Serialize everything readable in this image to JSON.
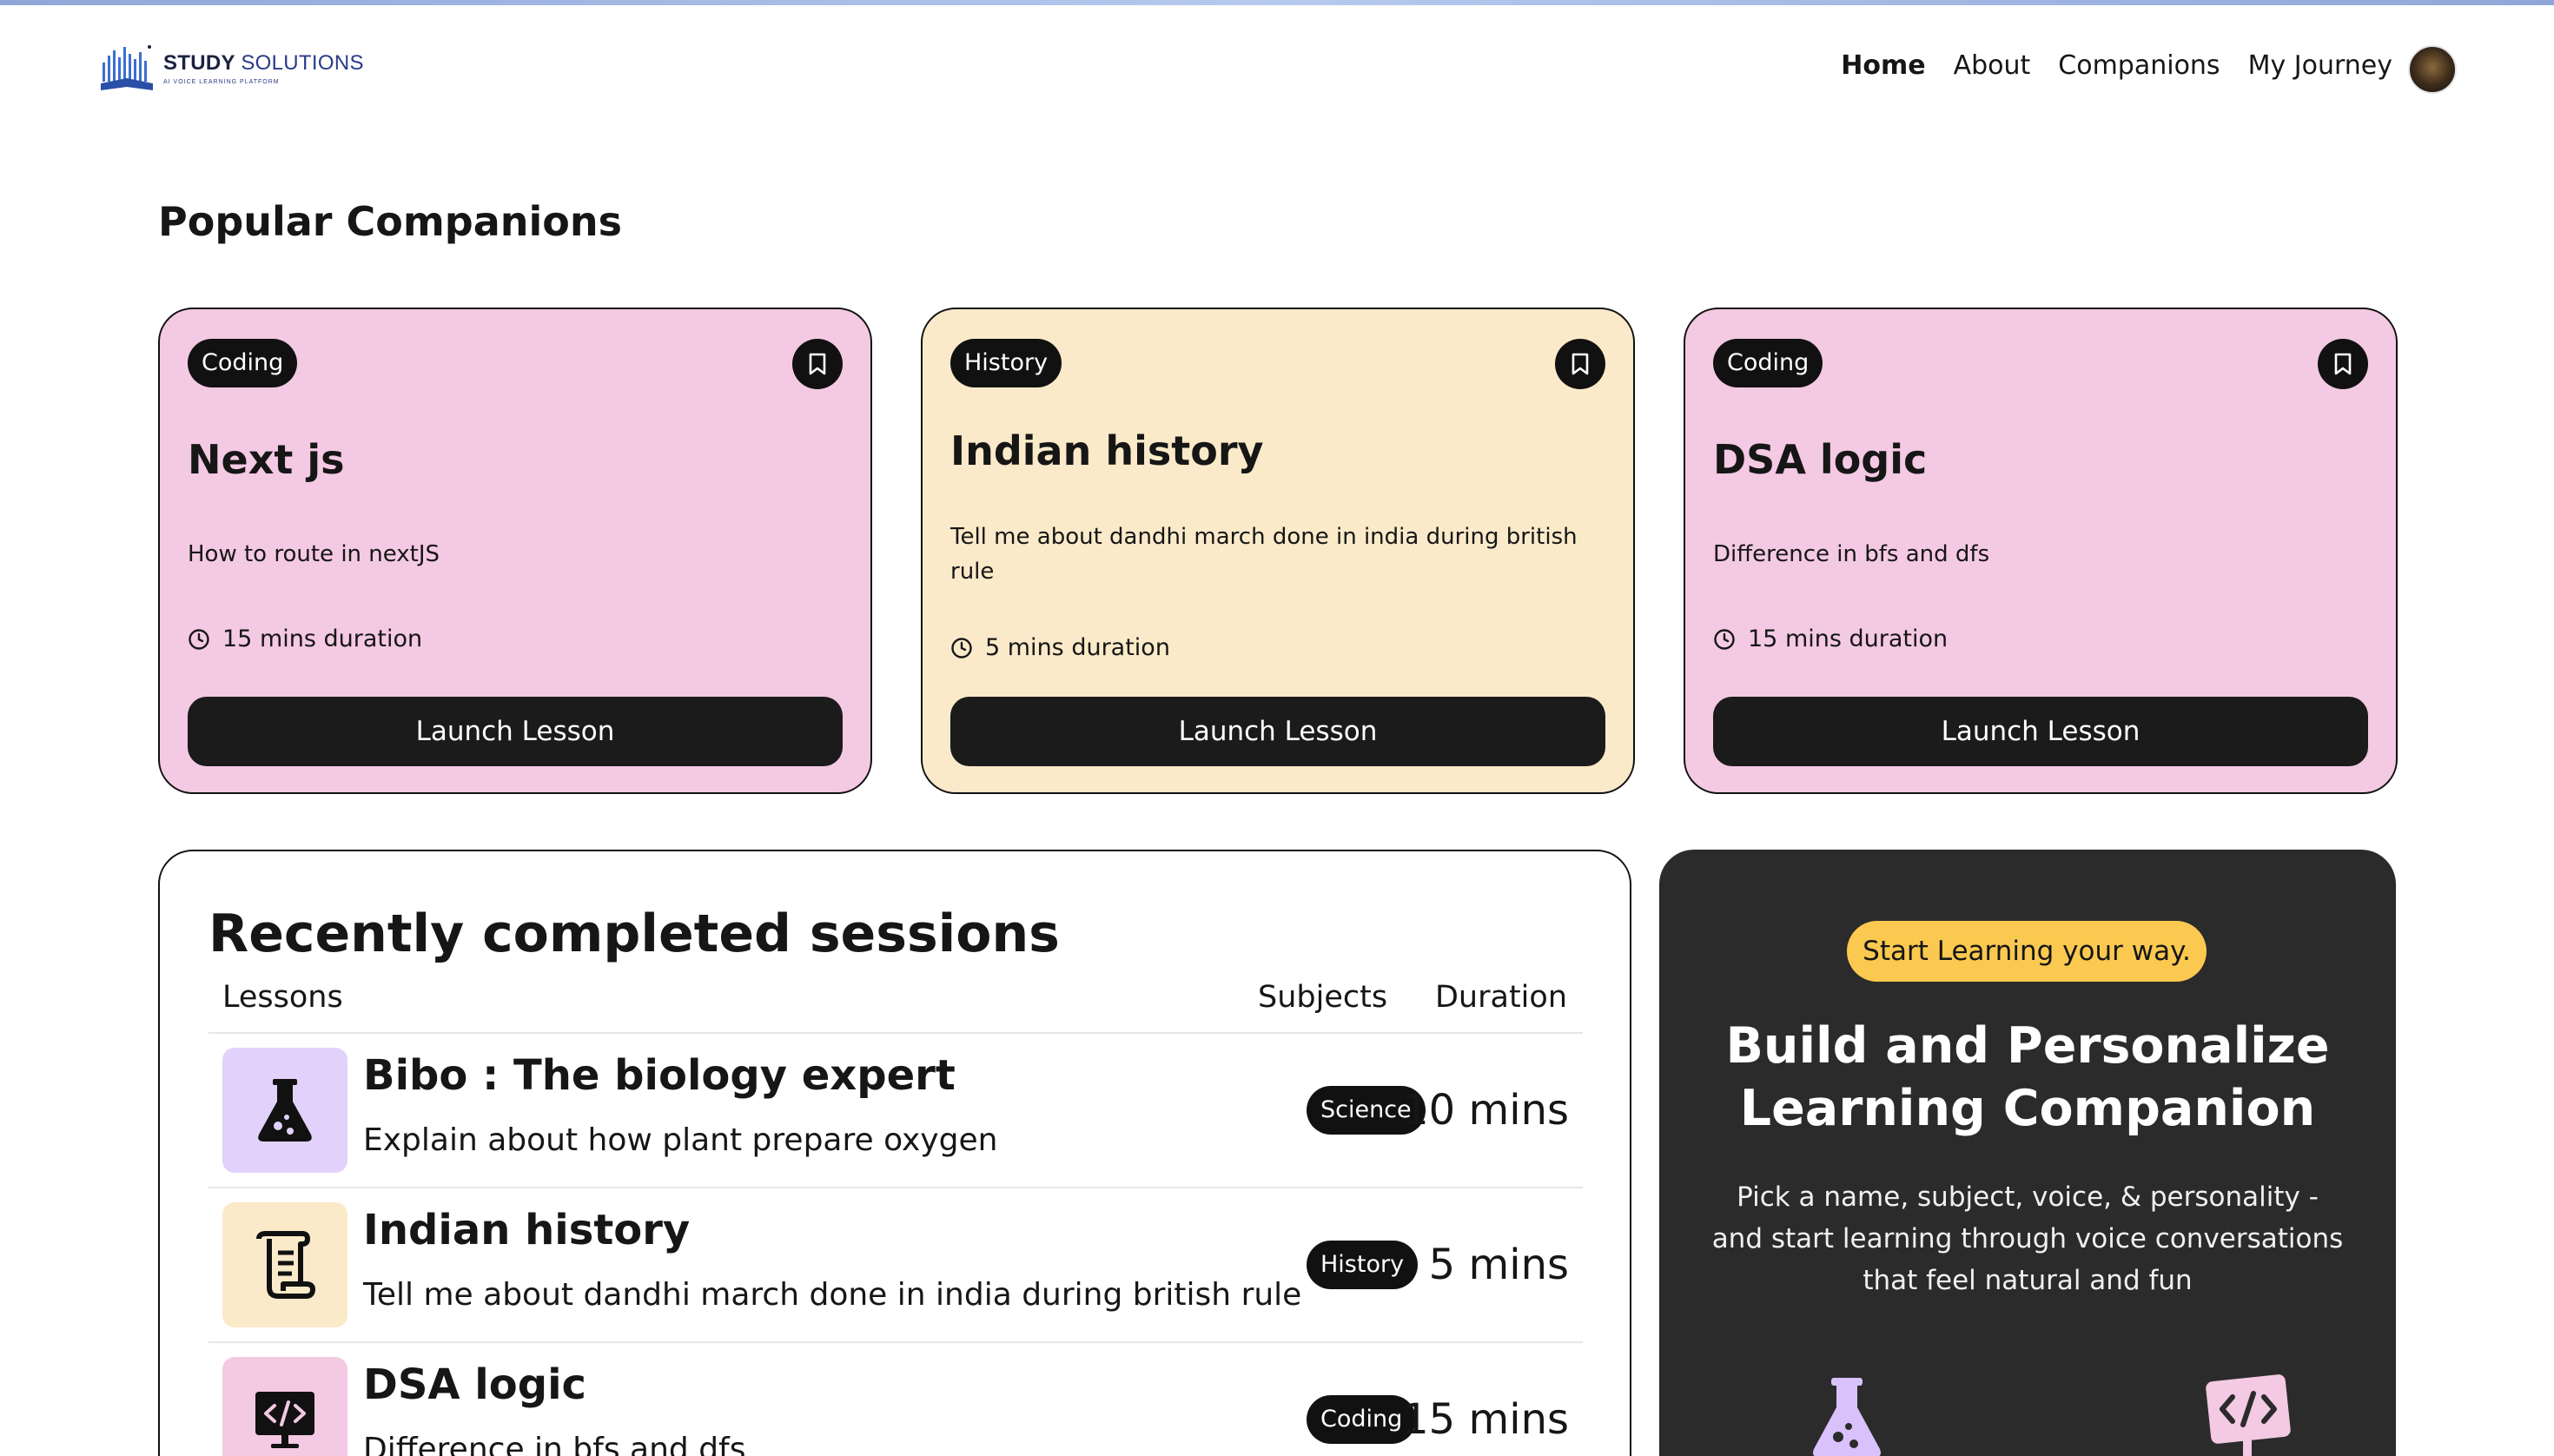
{
  "brand": {
    "name_bold": "STUDY",
    "name_light": "SOLUTIONS",
    "tagline": "AI VOICE LEARNING PLATFORM"
  },
  "nav": {
    "links": [
      "Home",
      "About",
      "Companions",
      "My Journey"
    ],
    "active": "Home"
  },
  "popular": {
    "title": "Popular Companions",
    "cards": [
      {
        "subject": "Coding",
        "name": "Next js",
        "topic": "How to route in nextJS",
        "duration": "15 mins duration",
        "button": "Launch Lesson",
        "color": "#f4c9e3"
      },
      {
        "subject": "History",
        "name": "Indian history",
        "topic": "Tell me about dandhi march done in india during british rule",
        "duration": "5 mins duration",
        "button": "Launch Lesson",
        "color": "#fbeac9"
      },
      {
        "subject": "Coding",
        "name": "DSA logic",
        "topic": "Difference in bfs and dfs",
        "duration": "15 mins duration",
        "button": "Launch Lesson",
        "color": "#f4c9e3"
      }
    ]
  },
  "recent": {
    "title": "Recently completed sessions",
    "headers": {
      "lessons": "Lessons",
      "subjects": "Subjects",
      "duration": "Duration"
    },
    "rows": [
      {
        "name": "Bibo : The biology expert",
        "topic": "Explain about how plant prepare oxygen",
        "subject": "Science",
        "duration": "10 mins",
        "icon": "flask-icon",
        "icon_bg": "#e2d1fb"
      },
      {
        "name": "Indian history",
        "topic": "Tell me about dandhi march done in india during british rule",
        "subject": "History",
        "duration": "5 mins",
        "icon": "scroll-icon",
        "icon_bg": "#fbeac9"
      },
      {
        "name": "DSA logic",
        "topic": "Difference in bfs and dfs",
        "subject": "Coding",
        "duration": "15 mins",
        "icon": "code-monitor-icon",
        "icon_bg": "#f4c9e3"
      }
    ]
  },
  "cta": {
    "pill": "Start Learning your way.",
    "title": "Build and Personalize Learning Companion",
    "description": "Pick a name, subject, voice, & personality - and start learning through voice conversations that feel natural and fun",
    "accent": "#fbc94f"
  }
}
